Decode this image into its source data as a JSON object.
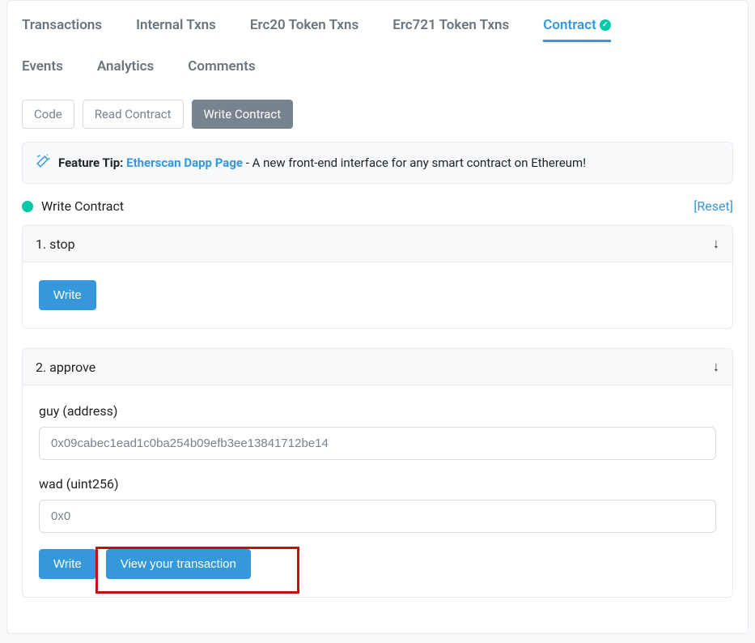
{
  "tabs": {
    "transactions": "Transactions",
    "internal": "Internal Txns",
    "erc20": "Erc20 Token Txns",
    "erc721": "Erc721 Token Txns",
    "contract": "Contract",
    "events": "Events",
    "analytics": "Analytics",
    "comments": "Comments"
  },
  "subtabs": {
    "code": "Code",
    "read": "Read Contract",
    "write": "Write Contract"
  },
  "tip": {
    "lead": "Feature Tip: ",
    "link": "Etherscan Dapp Page",
    "rest": " - A new front-end interface for any smart contract on Ethereum!"
  },
  "wc": {
    "title": "Write Contract",
    "reset": "[Reset]"
  },
  "func1": {
    "title": "1. stop",
    "write": "Write"
  },
  "func2": {
    "title": "2. approve",
    "guy_label": "guy (address)",
    "guy_value": "0x09cabec1ead1c0ba254b09efb3ee13841712be14",
    "wad_label": "wad (uint256)",
    "wad_value": "0x0",
    "write": "Write",
    "view": "View your transaction"
  }
}
